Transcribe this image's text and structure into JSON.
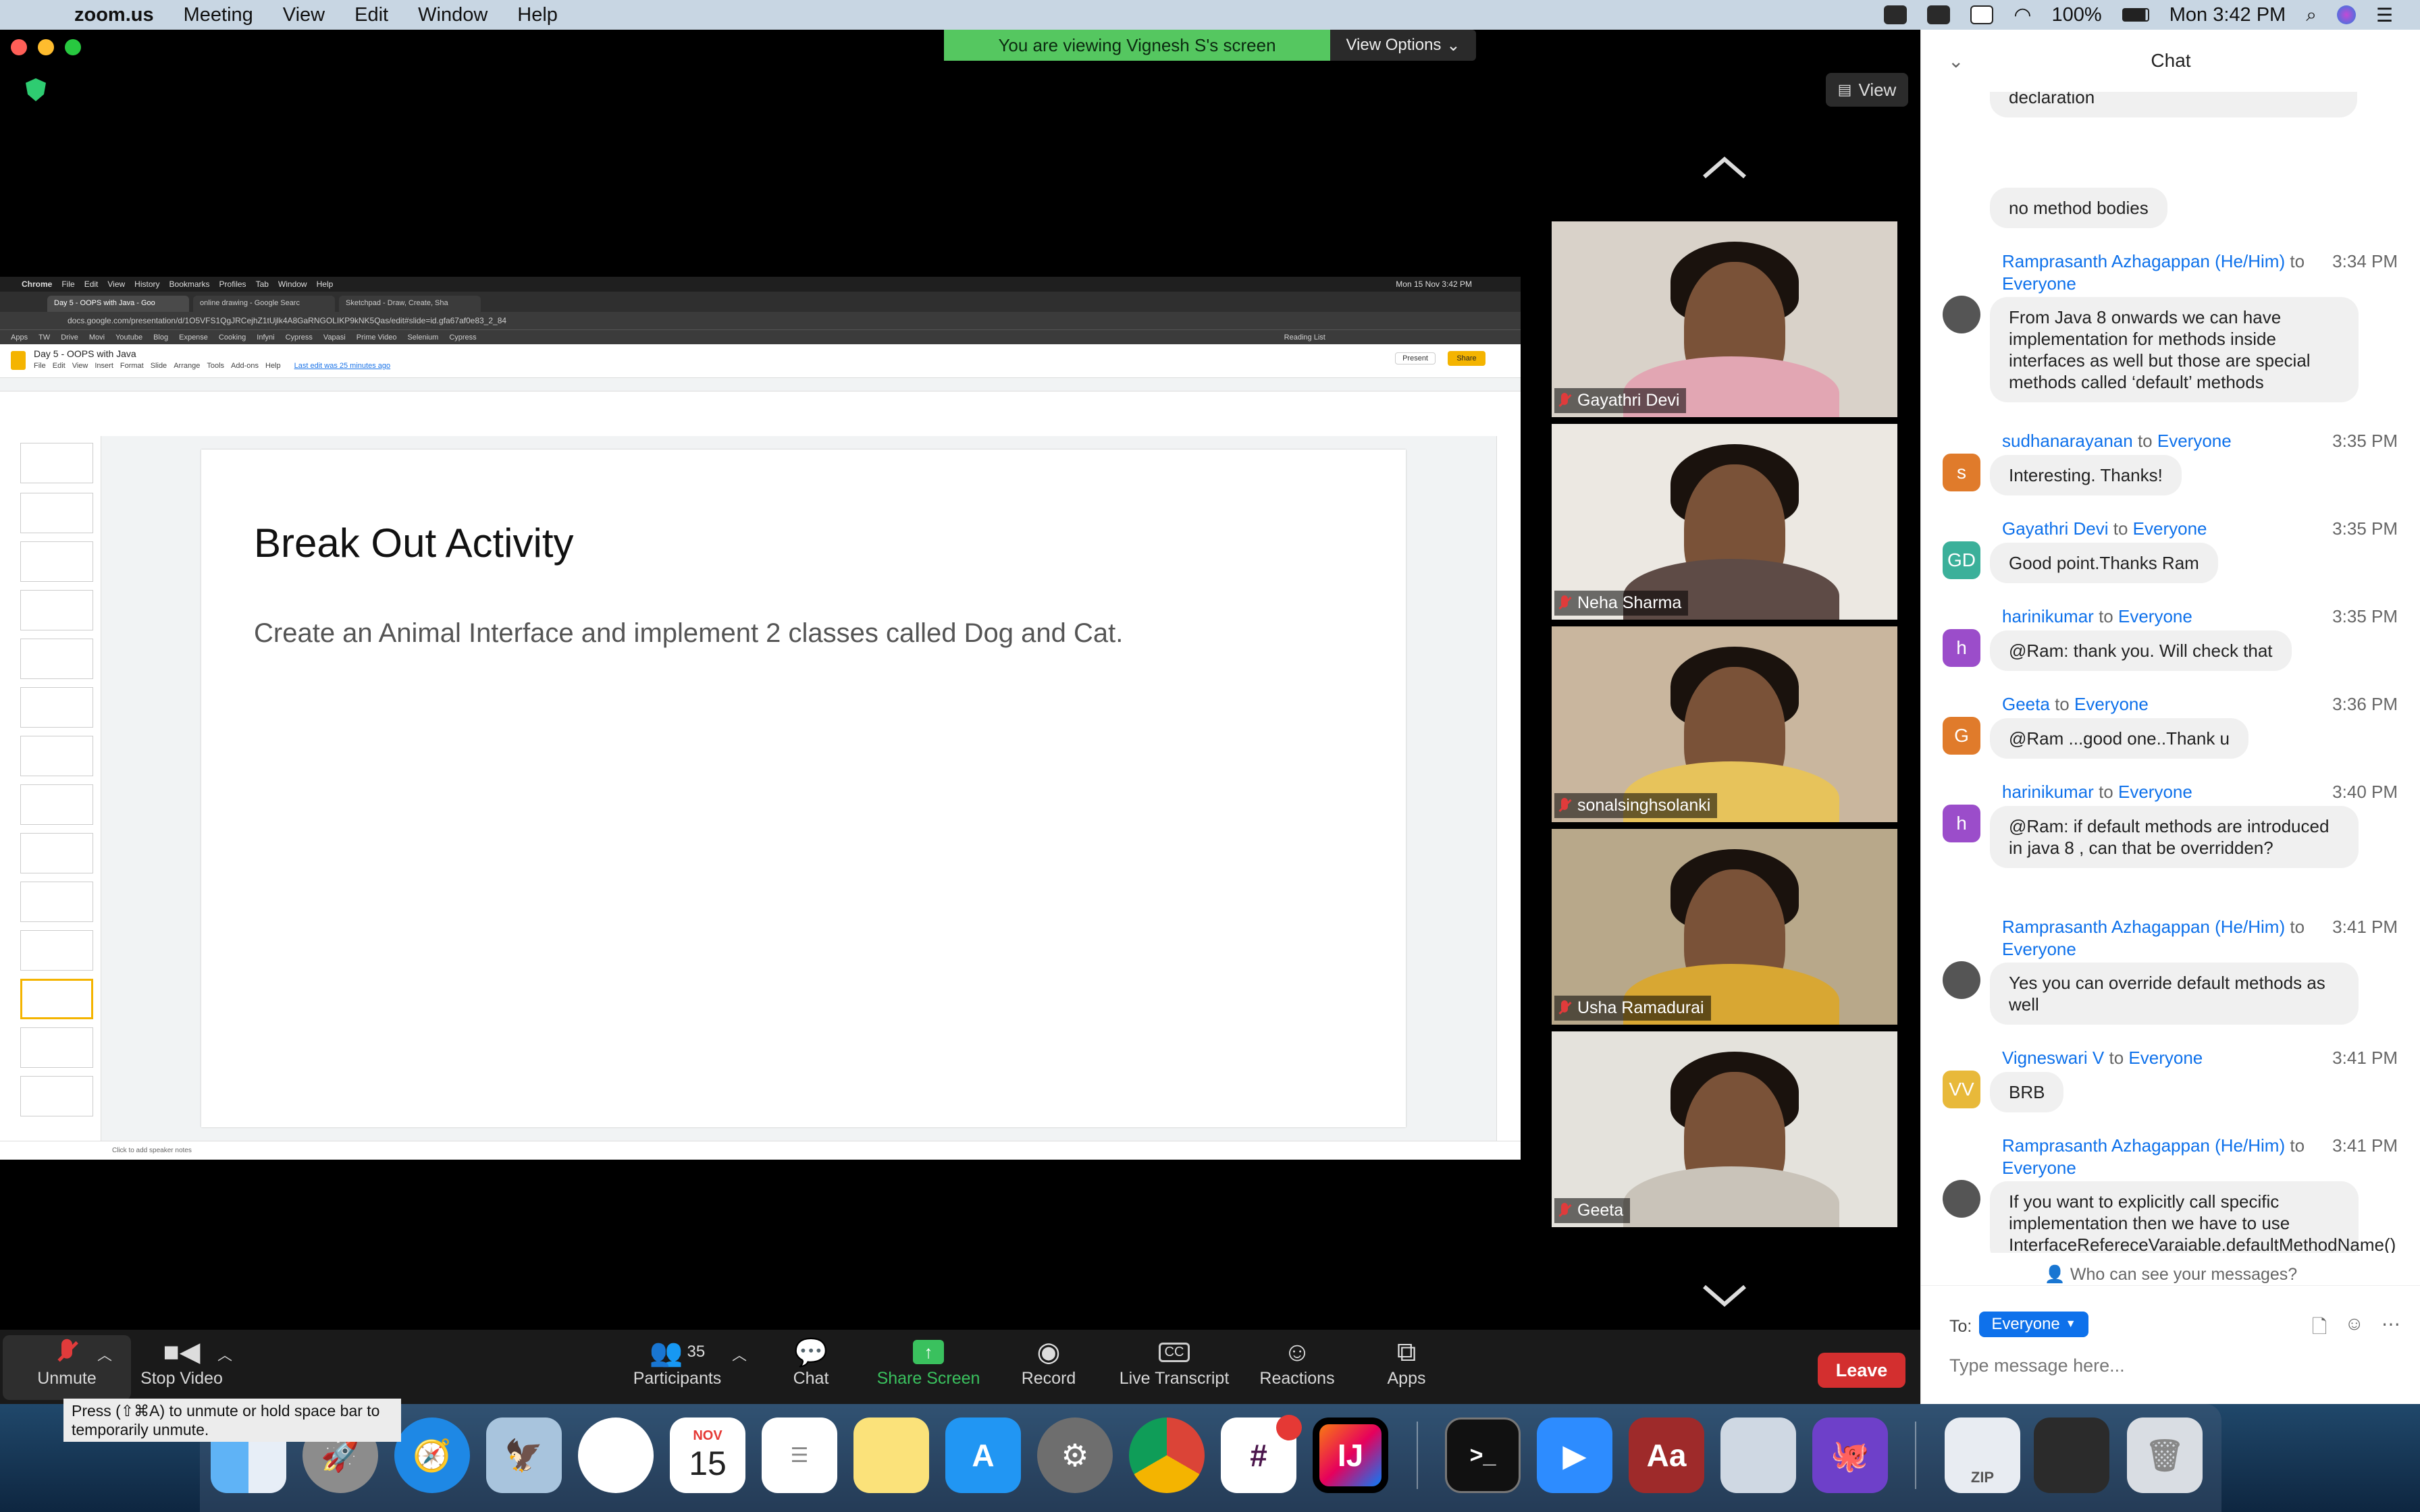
{
  "menubar": {
    "app": "zoom.us",
    "items": [
      "Meeting",
      "View",
      "Edit",
      "Window",
      "Help"
    ],
    "battery": "100%",
    "clock": "Mon 3:42 PM"
  },
  "banner": {
    "text": "You are viewing Vignesh S's screen",
    "view_options": "View Options"
  },
  "view_button": "View",
  "shared": {
    "mac_menu": [
      "Chrome",
      "File",
      "Edit",
      "View",
      "History",
      "Bookmarks",
      "Profiles",
      "Tab",
      "Window",
      "Help"
    ],
    "mac_clock": "Mon 15 Nov 3:42 PM",
    "tabs": [
      "Day 5 - OOPS with Java - Goo",
      "online drawing - Google Searc",
      "Sketchpad - Draw, Create, Sha"
    ],
    "url": "docs.google.com/presentation/d/1O5VFS1QgJRCejhZ1tUjlk4A8GaRNGOLIKP9kNK5Qas/edit#slide=id.gfa67af0e83_2_84",
    "bookmarks": [
      "Apps",
      "TW",
      "Drive",
      "Movi",
      "Youtube",
      "Blog",
      "Expense",
      "Cooking",
      "Infyni",
      "Cypress",
      "Vapasi",
      "Prime Video",
      "Selenium",
      "Cypress",
      "Reading List"
    ],
    "doc_title": "Day 5 - OOPS with Java",
    "doc_menu": [
      "File",
      "Edit",
      "View",
      "Insert",
      "Format",
      "Slide",
      "Arrange",
      "Tools",
      "Add-ons",
      "Help"
    ],
    "last_edit": "Last edit was 25 minutes ago",
    "present": "Present",
    "share": "Share",
    "slide_title": "Break Out Activity",
    "slide_body": "Create an Animal Interface and implement 2 classes called Dog and Cat.",
    "notes": "Click to add speaker notes"
  },
  "participants": [
    {
      "name": "Gayathri Devi",
      "bg": "#d9d2c9",
      "shirt": "#e2a6b3"
    },
    {
      "name": "Neha Sharma",
      "bg": "#ece8e2",
      "shirt": "#5e4b46"
    },
    {
      "name": "sonalsinghsolanki",
      "bg": "#c9b69e",
      "shirt": "#e7c35b"
    },
    {
      "name": "Usha Ramadurai",
      "bg": "#b8a88a",
      "shirt": "#d8a733"
    },
    {
      "name": "Geeta",
      "bg": "#e4e2dc",
      "shirt": "#c9c3b9"
    }
  ],
  "chat": {
    "title": "Chat",
    "top_fragment": "declaration",
    "first_bubble": "no method bodies",
    "messages": [
      {
        "sender": "Ramprasanth Azhagappan (He/Him)",
        "to": "to",
        "recipient": "Everyone",
        "time": "3:34 PM",
        "avatar": "",
        "avatar_color": "#555555",
        "text": "From Java 8 onwards we can have implementation for methods inside interfaces as well but those are special methods called ‘default’ methods"
      },
      {
        "sender": "sudhanarayanan",
        "to": "to",
        "recipient": "Everyone",
        "time": "3:35 PM",
        "avatar": "s",
        "avatar_color": "#e07b2b",
        "text": "Interesting. Thanks!"
      },
      {
        "sender": "Gayathri Devi",
        "to": "to",
        "recipient": "Everyone",
        "time": "3:35 PM",
        "avatar": "GD",
        "avatar_color": "#3bb09a",
        "text": "Good point.Thanks Ram"
      },
      {
        "sender": "harinikumar",
        "to": "to",
        "recipient": "Everyone",
        "time": "3:35 PM",
        "avatar": "h",
        "avatar_color": "#9b4dca",
        "text": "@Ram: thank you. Will check that"
      },
      {
        "sender": "Geeta",
        "to": "to",
        "recipient": "Everyone",
        "time": "3:36 PM",
        "avatar": "G",
        "avatar_color": "#e07b2b",
        "text": "@Ram ...good one..Thank u"
      },
      {
        "sender": "harinikumar",
        "to": "to",
        "recipient": "Everyone",
        "time": "3:40 PM",
        "avatar": "h",
        "avatar_color": "#9b4dca",
        "text": "@Ram: if default methods are introduced in java 8 , can that be overridden?"
      },
      {
        "sender": "Ramprasanth Azhagappan (He/Him)",
        "to": "to",
        "recipient": "Everyone",
        "time": "3:41 PM",
        "avatar": "",
        "avatar_color": "#555555",
        "text": "Yes you can override default methods as well"
      },
      {
        "sender": "Vigneswari V",
        "to": "to",
        "recipient": "Everyone",
        "time": "3:41 PM",
        "avatar": "VV",
        "avatar_color": "#e8b93a",
        "text": "BRB"
      },
      {
        "sender": "Ramprasanth Azhagappan (He/Him)",
        "to": "to",
        "recipient": "Everyone",
        "time": "3:41 PM",
        "avatar": "",
        "avatar_color": "#555555",
        "text": "If you want to explicitly call specific implementation then we have to use InterfaceRefereceVaraiable.defaultMethodName()"
      }
    ],
    "who_can_see": "Who can see your messages?",
    "to_label": "To:",
    "to_value": "Everyone",
    "placeholder": "Type message here..."
  },
  "toolbar": {
    "unmute": "Unmute",
    "stop_video": "Stop Video",
    "participants": "Participants",
    "participants_count": "35",
    "chat": "Chat",
    "share_screen": "Share Screen",
    "record": "Record",
    "live_transcript": "Live Transcript",
    "reactions": "Reactions",
    "apps": "Apps",
    "leave": "Leave",
    "tooltip": "Press  (⇧⌘A) to unmute or hold space bar to temporarily unmute."
  },
  "dock": {
    "calendar_month": "NOV",
    "calendar_day": "15",
    "slack_badge": "",
    "intellij_label": "IJ",
    "zip_label": "ZIP"
  }
}
